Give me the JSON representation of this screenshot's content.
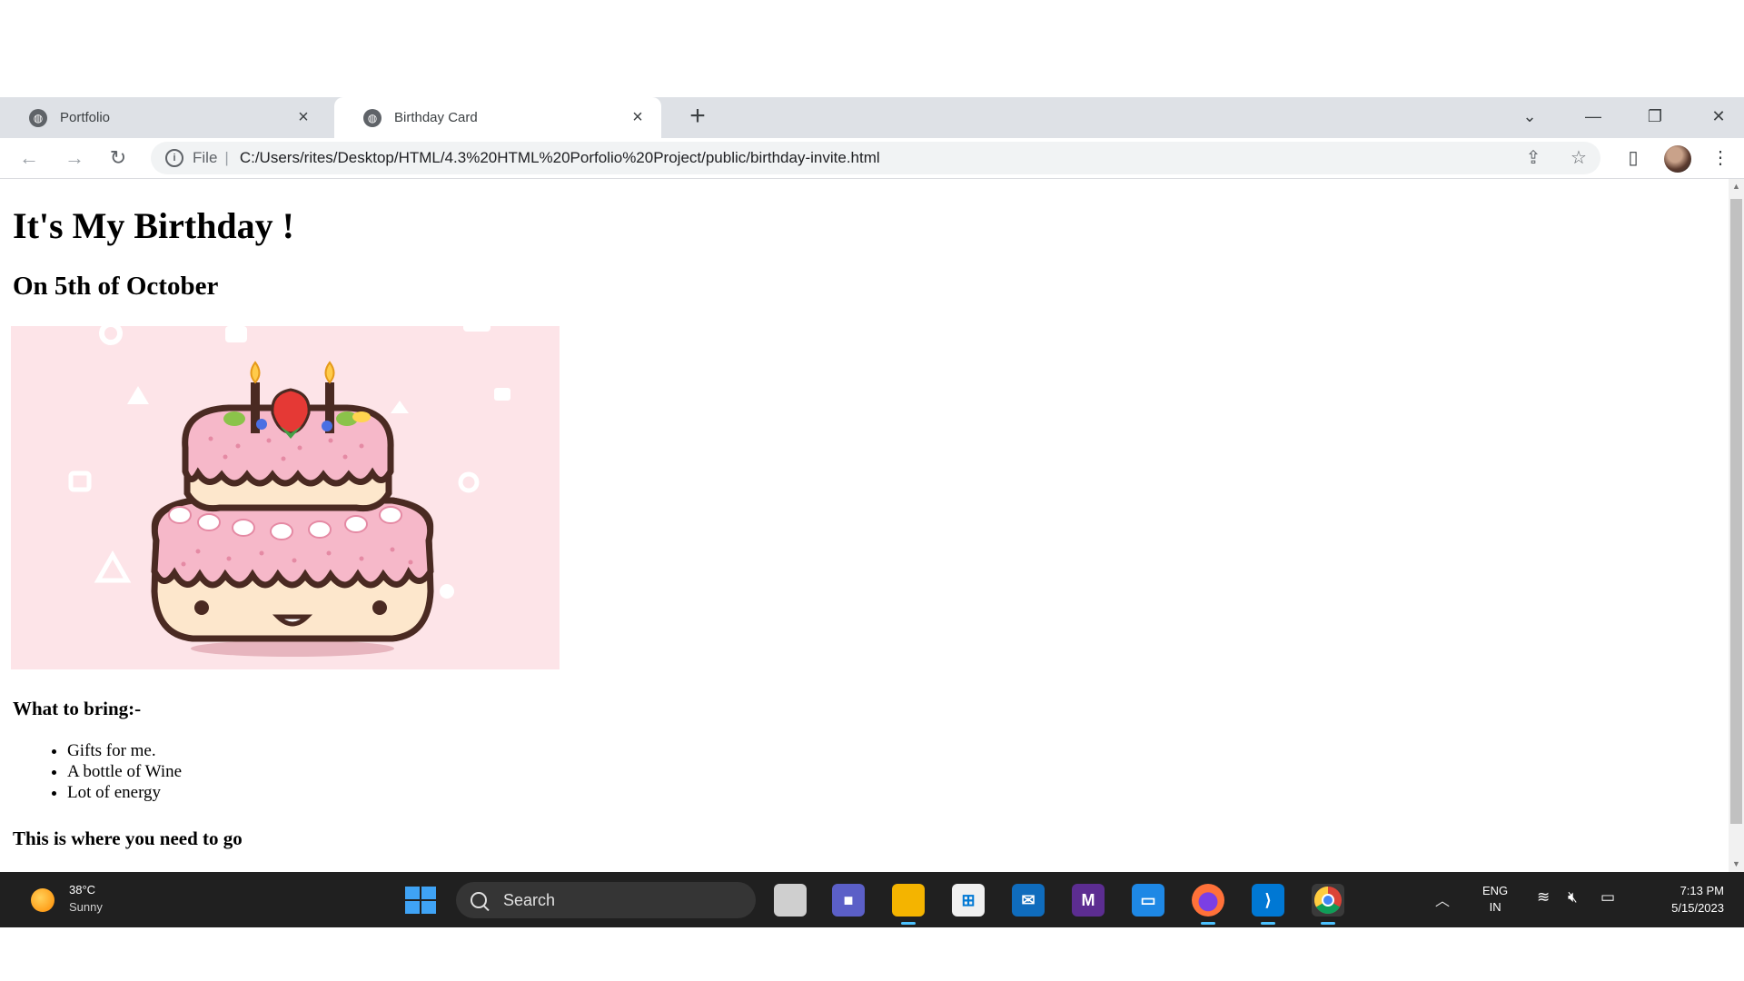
{
  "browser": {
    "tabs": [
      {
        "title": "Portfolio",
        "active": false
      },
      {
        "title": "Birthday Card",
        "active": true
      }
    ],
    "new_tab_glyph": "+",
    "window_controls": {
      "menu": "⌄",
      "minimize": "—",
      "restore": "❐",
      "close": "✕"
    },
    "omnibox": {
      "scheme": "File",
      "separator": "|",
      "url": "C:/Users/rites/Desktop/HTML/4.3%20HTML%20Porfolio%20Project/public/birthday-invite.html"
    },
    "icons": {
      "back": "back-arrow-icon",
      "forward": "forward-arrow-icon",
      "reload": "reload-icon",
      "info": "info-icon",
      "share": "share-icon",
      "bookmark": "star-icon",
      "side_panel": "side-panel-icon",
      "profile": "avatar",
      "menu": "kebab-menu-icon"
    }
  },
  "page": {
    "heading": "It's My Birthday !",
    "subheading": "On 5th of October",
    "image": "birthday-cake-illustration",
    "bring_heading": "What to bring:-",
    "bring_items": [
      "Gifts for me.",
      "A bottle of Wine",
      "Lot of energy"
    ],
    "go_heading": "This is where you need to go"
  },
  "taskbar": {
    "weather": {
      "temp": "38°C",
      "condition": "Sunny"
    },
    "search_placeholder": "Search",
    "apps": [
      {
        "name": "task-view",
        "active": false
      },
      {
        "name": "meet",
        "active": false
      },
      {
        "name": "file-explorer",
        "active": true
      },
      {
        "name": "microsoft-store",
        "active": false
      },
      {
        "name": "mail",
        "active": false
      },
      {
        "name": "visual-studio",
        "active": false
      },
      {
        "name": "remote-desktop",
        "active": false
      },
      {
        "name": "firefox",
        "active": true
      },
      {
        "name": "vscode",
        "active": true
      },
      {
        "name": "chrome",
        "active": true
      }
    ],
    "language": {
      "line1": "ENG",
      "line2": "IN"
    },
    "clock": {
      "time": "7:13 PM",
      "date": "5/15/2023"
    }
  },
  "colors": {
    "tabstrip": "#dee1e6",
    "taskbar": "#202020",
    "cake_background": "#fde4e8",
    "accent": "#4cc2ff"
  }
}
